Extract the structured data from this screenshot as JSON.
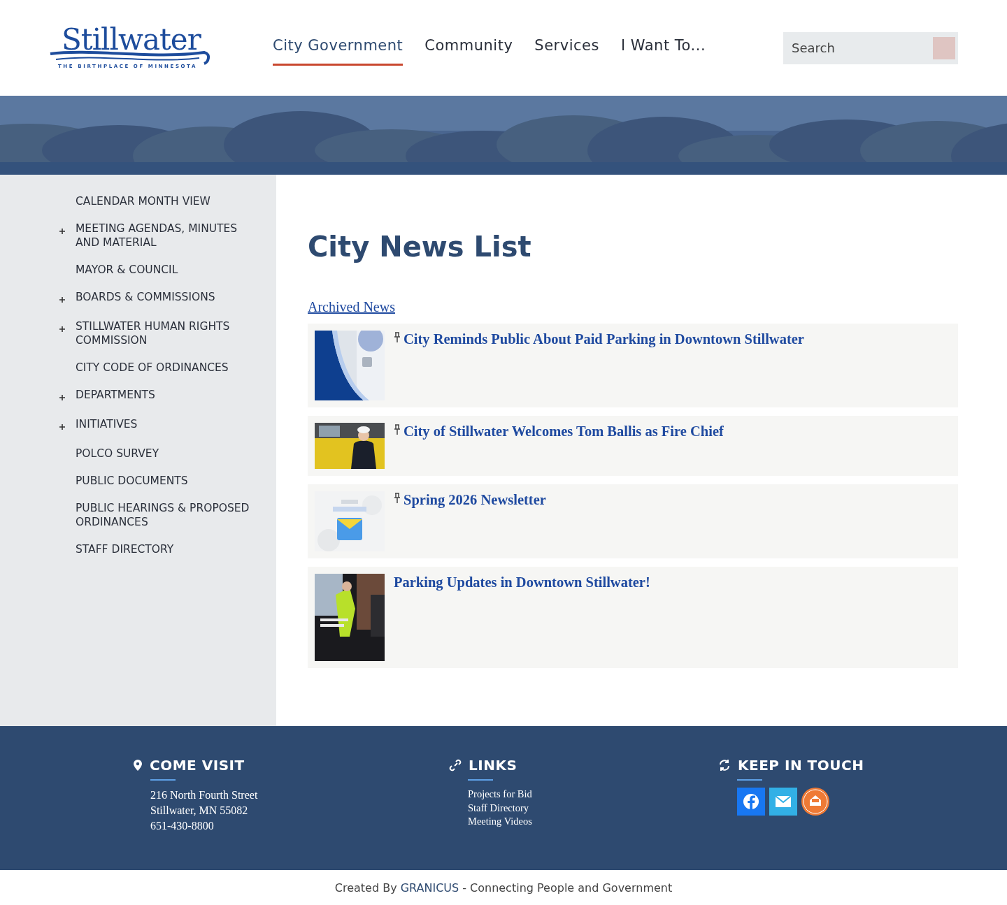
{
  "header": {
    "logo": {
      "wordmark": "Stillwater",
      "tagline": "THE BIRTHPLACE OF MINNESOTA"
    },
    "nav": [
      {
        "label": "City Government",
        "selected": true
      },
      {
        "label": "Community",
        "selected": false
      },
      {
        "label": "Services",
        "selected": false
      },
      {
        "label": "I Want To...",
        "selected": false
      }
    ],
    "search": {
      "placeholder": "Search"
    }
  },
  "sidebar": {
    "items": [
      {
        "label": "CALENDAR MONTH VIEW",
        "has_children": false
      },
      {
        "label": "MEETING AGENDAS, MINUTES AND MATERIAL",
        "has_children": true
      },
      {
        "label": "MAYOR & COUNCIL",
        "has_children": false
      },
      {
        "label": "BOARDS & COMMISSIONS",
        "has_children": true
      },
      {
        "label": "STILLWATER HUMAN RIGHTS COMMISSION",
        "has_children": true
      },
      {
        "label": "CITY CODE OF ORDINANCES",
        "has_children": false
      },
      {
        "label": "DEPARTMENTS",
        "has_children": true
      },
      {
        "label": "INITIATIVES",
        "has_children": true
      },
      {
        "label": "POLCO SURVEY",
        "has_children": false
      },
      {
        "label": "PUBLIC DOCUMENTS",
        "has_children": false
      },
      {
        "label": "PUBLIC HEARINGS & PROPOSED ORDINANCES",
        "has_children": false
      },
      {
        "label": "STAFF DIRECTORY",
        "has_children": false
      }
    ]
  },
  "main": {
    "title": "City News List",
    "archive_link": "Archived News",
    "news": [
      {
        "title": "City Reminds Public About Paid Parking in Downtown Stillwater",
        "pinned": true
      },
      {
        "title": "City of Stillwater Welcomes Tom Ballis as Fire Chief",
        "pinned": true
      },
      {
        "title": "Spring 2026 Newsletter",
        "pinned": true
      },
      {
        "title": "Parking Updates in Downtown Stillwater!",
        "pinned": false
      }
    ]
  },
  "footer": {
    "visit": {
      "heading": "COME VISIT",
      "lines": [
        "216 North Fourth Street",
        "Stillwater, MN 55082",
        "651-430-8800"
      ]
    },
    "links": {
      "heading": "LINKS",
      "items": [
        "Projects for Bid",
        "Staff Directory",
        "Meeting Videos"
      ]
    },
    "touch": {
      "heading": "KEEP IN TOUCH",
      "socials": [
        {
          "kind": "facebook"
        },
        {
          "kind": "email"
        },
        {
          "kind": "signup"
        }
      ]
    }
  },
  "credit": {
    "before": "Created By",
    "brand": "GRANICUS",
    "after": "- Connecting People and Government"
  }
}
